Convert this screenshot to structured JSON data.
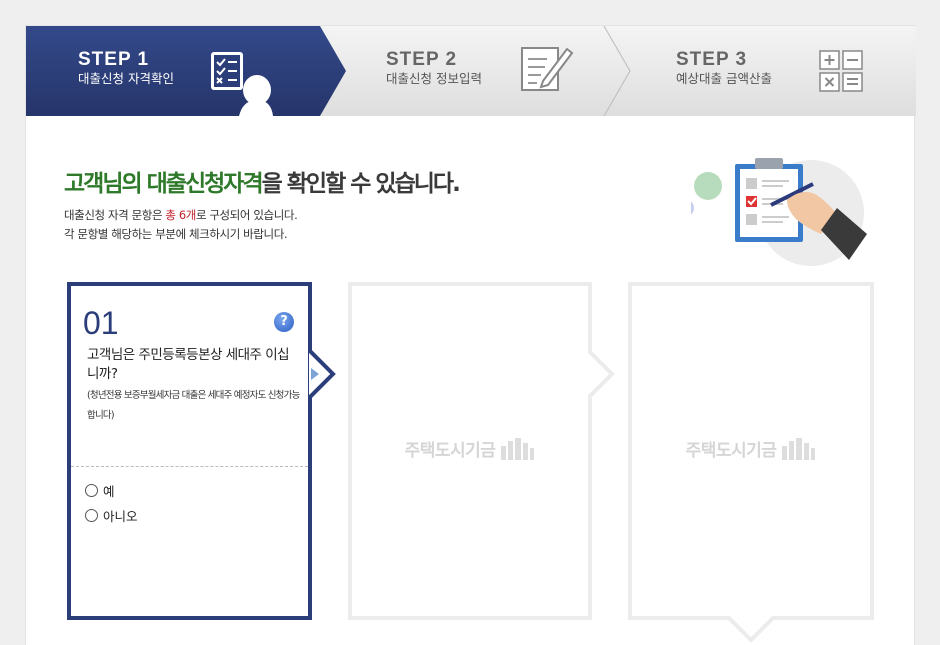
{
  "steps": [
    {
      "title": "STEP 1",
      "sub": "대출신청 자격확인",
      "icon": "checklist-person-icon",
      "active": true
    },
    {
      "title": "STEP 2",
      "sub": "대출신청 정보입력",
      "icon": "document-pencil-icon",
      "active": false
    },
    {
      "title": "STEP 3",
      "sub": "예상대출 금액산출",
      "icon": "calculator-icon",
      "active": false
    }
  ],
  "colors": {
    "step_active": "#2c3e7a",
    "step_inactive": "#e9e9e9",
    "headline_green": "#2f7a2a",
    "highlight_red": "#c0202a"
  },
  "heading": {
    "green": "고객님의 대출신청자격",
    "rest": "을 확인할 수 있습니다."
  },
  "desc": {
    "line1_pre": "대출신청 자격 문항은 ",
    "line1_highlight": "총 6개",
    "line1_post": "로 구성되어 있습니다.",
    "line2": "각 문항별 해당하는 부분에 체크하시기 바랍니다."
  },
  "question": {
    "number": "01",
    "help": "?",
    "text": "고객님은 주민등록등본상 세대주 이십니까?",
    "note": "(청년전용 보증부월세자금 대출은 세대주 예정자도 신청가능합니다)",
    "options": [
      "예",
      "아니오"
    ]
  },
  "placeholder_cards": [
    {
      "watermark": "주택도시기금"
    },
    {
      "watermark": "주택도시기금"
    }
  ]
}
